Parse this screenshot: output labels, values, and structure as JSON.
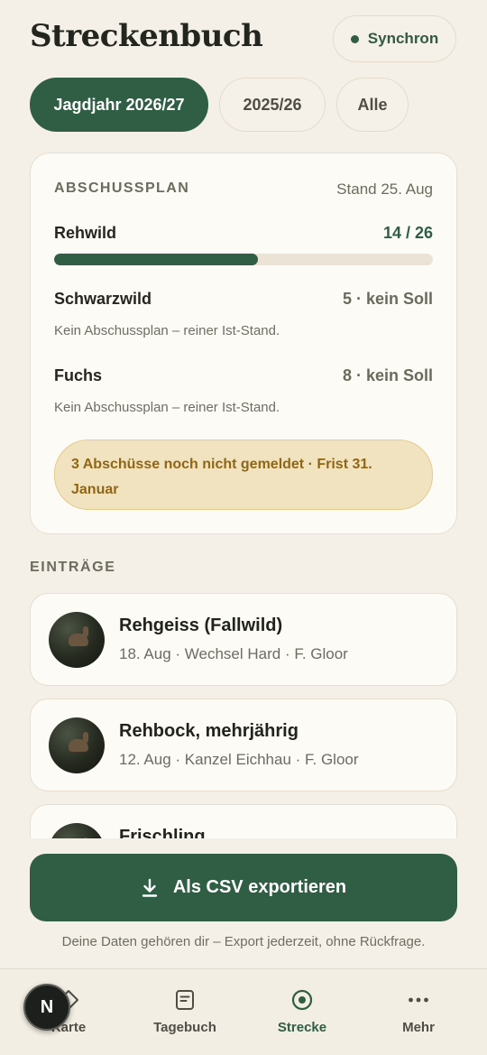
{
  "header": {
    "title": "Streckenbuch",
    "sync_label": "Synchron"
  },
  "year_tabs": [
    {
      "label": "Jagdjahr 2026/27",
      "active": true
    },
    {
      "label": "2025/26",
      "active": false
    },
    {
      "label": "Alle",
      "active": false
    }
  ],
  "plan": {
    "heading": "ABSCHUSSPLAN",
    "stand": "Stand 25. Aug",
    "rows": [
      {
        "name": "Rehwild",
        "count": "14 / 26",
        "progress": 0.538
      },
      {
        "name": "Schwarzwild",
        "count": "5 · kein Soll",
        "note": "Kein Abschussplan – reiner Ist-Stand."
      },
      {
        "name": "Fuchs",
        "count": "8 · kein Soll",
        "note": "Kein Abschussplan – reiner Ist-Stand."
      }
    ],
    "warning": "3 Abschüsse noch nicht gemeldet · Frist 31. Januar"
  },
  "entries": {
    "heading": "EINTRÄGE",
    "items": [
      {
        "title": "Rehgeiss (Fallwild)",
        "meta": "18. Aug · Wechsel Hard · F. Gloor"
      },
      {
        "title": "Rehbock, mehrjährig",
        "meta": "12. Aug · Kanzel Eichhau · F. Gloor"
      },
      {
        "title": "Frischling",
        "meta": ""
      }
    ]
  },
  "export": {
    "button_label": "Als CSV exportieren",
    "note": "Deine Daten gehören dir – Export jederzeit, ohne Rückfrage."
  },
  "nav": [
    {
      "label": "Karte",
      "icon": "map-diamond-icon",
      "active": false
    },
    {
      "label": "Tagebuch",
      "icon": "journal-icon",
      "active": false
    },
    {
      "label": "Strecke",
      "icon": "target-icon",
      "active": true
    },
    {
      "label": "Mehr",
      "icon": "more-dots-icon",
      "active": false
    }
  ],
  "avatar": {
    "initial": "N"
  },
  "colors": {
    "accent": "#2f5e45",
    "background": "#f5f0e7",
    "warning_bg": "#f2e3c0",
    "warning_text": "#8e6616"
  }
}
